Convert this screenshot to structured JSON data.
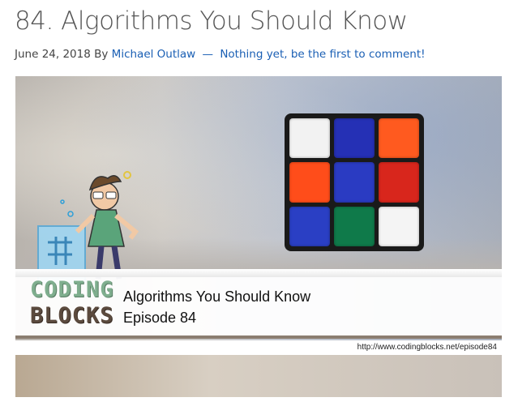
{
  "post": {
    "title": "84. Algorithms You Should Know",
    "date": "June 24, 2018",
    "by_label": "By",
    "author": "Michael Outlaw",
    "separator": "—",
    "comments_link": "Nothing yet, be the first to comment!"
  },
  "hero": {
    "logo_line1": "CODING",
    "logo_line2": "BLOCKS",
    "episode_title": "Algorithms You Should Know",
    "episode_number": "Episode 84",
    "url": "http://www.codingblocks.net/episode84"
  },
  "cube_colors": {
    "row1": [
      "#f2f2f2",
      "#2530b5",
      "#ff5a1f"
    ],
    "row2": [
      "#ff4d1a",
      "#2a3bc2",
      "#d8261c"
    ],
    "row3": [
      "#2a3fc4",
      "#0f7a4a",
      "#f4f4f4"
    ]
  }
}
